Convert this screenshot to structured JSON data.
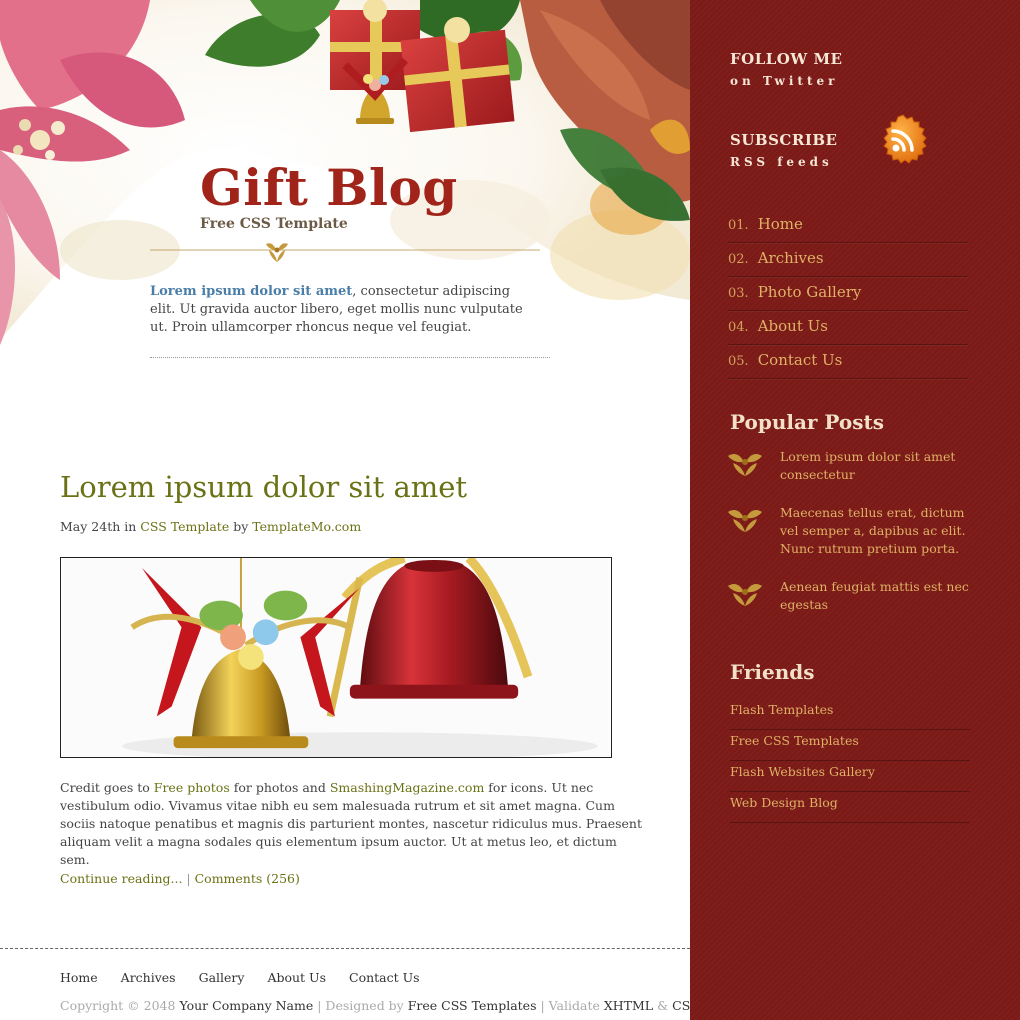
{
  "header": {
    "title": "Gift Blog",
    "subtitle": "Free CSS Template",
    "intro_link": "Lorem ipsum dolor sit amet",
    "intro_text": ", consectetur adipiscing elit. Ut gravida auctor libero, eget mollis nunc vulputate ut. Proin ullamcorper rhoncus neque vel feugiat."
  },
  "post": {
    "title": "Lorem ipsum dolor sit amet",
    "date": "May 24th",
    "in_word": " in ",
    "category": "CSS Template",
    "by_word": " by ",
    "author": "TemplateMo.com",
    "body_prefix": "Credit goes to ",
    "body_link1": "Free photos",
    "body_mid": " for photos and ",
    "body_link2": "SmashingMagazine.com",
    "body_suffix": " for icons. Ut nec vestibulum odio. Vivamus vitae nibh eu sem malesuada rutrum et sit amet magna. Cum sociis natoque penatibus et magnis dis parturient montes, nascetur ridiculus mus. Praesent aliquam velit a magna sodales quis elementum ipsum auctor. Ut at metus leo, et dictum sem.",
    "continue_label": "Continue reading...",
    "separator": " | ",
    "comments_label": "Comments (256)"
  },
  "footer": {
    "nav": [
      "Home",
      "Archives",
      "Gallery",
      "About Us",
      "Contact Us"
    ],
    "copyright_prefix": "Copyright © 2048 ",
    "company": "Your Company Name",
    "sep1": " | Designed by ",
    "designer": "Free CSS Templates",
    "sep2": " | Validate ",
    "xhtml": "XHTML",
    "amp": " & ",
    "css": "CSS"
  },
  "sidebar": {
    "follow_title": "FOLLOW ME",
    "follow_sub": "on Twitter",
    "subscribe_title": "SUBSCRIBE",
    "subscribe_sub": "RSS feeds",
    "nav": [
      {
        "num": "01.",
        "label": "Home"
      },
      {
        "num": "02.",
        "label": "Archives"
      },
      {
        "num": "03.",
        "label": "Photo Gallery"
      },
      {
        "num": "04.",
        "label": "About Us"
      },
      {
        "num": "05.",
        "label": "Contact Us"
      }
    ],
    "popular_title": "Popular Posts",
    "popular": [
      "Lorem ipsum dolor sit amet consectetur",
      "Maecenas tellus erat, dictum vel semper a, dapibus ac elit. Nunc rutrum pretium porta.",
      "Aenean feugiat mattis est nec egestas"
    ],
    "friends_title": "Friends",
    "friends": [
      "Flash Templates",
      "Free CSS Templates",
      "Flash Websites Gallery",
      "Web Design Blog"
    ]
  },
  "icons": {
    "rss": "rss-icon",
    "holly": "holly-icon",
    "header_art": "poinsettia-gift-boxes-illustration",
    "post_image": "christmas-bells-photo"
  },
  "colors": {
    "title_red": "#a1241a",
    "olive": "#6b7216",
    "sidebar_bg": "#7b1a17",
    "sidebar_link": "#dfb266",
    "intro_link": "#4a7ea8",
    "rss_orange": "#f08a1c"
  }
}
